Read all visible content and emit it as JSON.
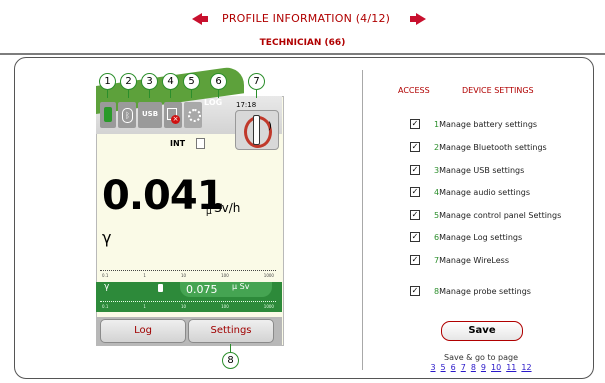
{
  "header": {
    "title": "PROFILE INFORMATION (4/12)",
    "subtitle": "TECHNICIAN (66)"
  },
  "device": {
    "time": "17:18",
    "log_badge": "LOG",
    "usb_label": "USB",
    "int_label": "INT",
    "big_value": "0.041",
    "unit_prefix": "μ",
    "unit": "Sv/h",
    "gamma": "γ",
    "scale_ticks": [
      "0.1",
      "1",
      "10",
      "100",
      "1000"
    ],
    "dose_value": "0.075",
    "dose_unit": "μ Sv",
    "log_button": "Log",
    "settings_button": "Settings",
    "callouts": [
      "1",
      "2",
      "3",
      "4",
      "5",
      "6",
      "7",
      "8"
    ]
  },
  "access": {
    "col_access": "ACCESS",
    "col_settings": "DEVICE SETTINGS",
    "items": [
      {
        "num": "1",
        "label": "Manage battery settings",
        "checked": true
      },
      {
        "num": "2",
        "label": "Manage Bluetooth settings",
        "checked": true
      },
      {
        "num": "3",
        "label": "Manage USB settings",
        "checked": true
      },
      {
        "num": "4",
        "label": "Manage audio settings",
        "checked": true
      },
      {
        "num": "5",
        "label": "Manage control panel Settings",
        "checked": true
      },
      {
        "num": "6",
        "label": "Manage Log settings",
        "checked": true
      },
      {
        "num": "7",
        "label": "Manage WireLess",
        "checked": true
      },
      {
        "num": "8",
        "label": "Manage probe settings",
        "checked": true
      }
    ],
    "checkmark": "✓",
    "save_label": "Save",
    "save_go": "Save & go to page",
    "pages": [
      "3",
      "5",
      "6",
      "7",
      "8",
      "9",
      "10",
      "11",
      "12"
    ]
  },
  "colors": {
    "accent": "#b00000",
    "green": "#2b8e2b",
    "link": "#2a18c9"
  }
}
